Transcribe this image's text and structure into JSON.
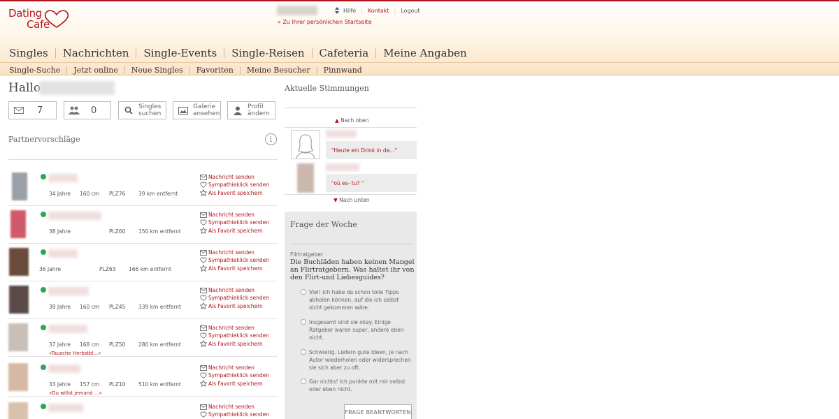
{
  "brand": {
    "line1": "Dating",
    "line2": "Cafe",
    "color": "#b0141c"
  },
  "top_links": {
    "hilfe": "Hilfe",
    "kontakt": "Kontakt",
    "logout": "Logout",
    "startseite": "» Zu Ihrer persönlichen Startseite"
  },
  "main_nav": [
    "Singles",
    "Nachrichten",
    "Single-Events",
    "Single-Reisen",
    "Cafeteria",
    "Meine Angaben"
  ],
  "sub_nav": [
    "Single-Suche",
    "Jetzt online",
    "Neue Singles",
    "Favoriten",
    "Meine Besucher",
    "Pinnwand"
  ],
  "greeting": "Hallo",
  "quick": {
    "messages_count": "7",
    "contacts_count": "0",
    "search_label_1": "Singles",
    "search_label_2": "suchen",
    "gallery_label_1": "Galerie",
    "gallery_label_2": "ansehen",
    "profile_label_1": "Profil",
    "profile_label_2": "ändern"
  },
  "partner_title": "Partnervorschläge",
  "partners": [
    {
      "age": "34 Jahre",
      "height": "160 cm",
      "plz": "PLZ76",
      "distance": "39 km entfernt",
      "status": ""
    },
    {
      "age": "38 Jahre",
      "height": "",
      "plz": "PLZ60",
      "distance": "150 km entfernt",
      "status": ""
    },
    {
      "age": "36 Jahre",
      "height": "",
      "plz": "PLZ63",
      "distance": "166 km entfernt",
      "status": ""
    },
    {
      "age": "39 Jahre",
      "height": "160 cm",
      "plz": "PLZ45",
      "distance": "339 km entfernt",
      "status": ""
    },
    {
      "age": "37 Jahre",
      "height": "168 cm",
      "plz": "PLZ50",
      "distance": "280 km entfernt",
      "status": "»Tausche Herbstbl...«"
    },
    {
      "age": "33 Jahre",
      "height": "157 cm",
      "plz": "PLZ10",
      "distance": "510 km entfernt",
      "status": "»Du willst jemand ...«"
    },
    {
      "age": "",
      "height": "",
      "plz": "",
      "distance": "",
      "status": ""
    }
  ],
  "actions": {
    "message": "Nachricht senden",
    "sympathy": "Sympathieklick senden",
    "favorite": "Als Favorit speichern"
  },
  "stimmungen": {
    "title": "Aktuelle Stimmungen",
    "up": "Nach oben",
    "down": "Nach unten",
    "entries": [
      {
        "text": "\"Heute ein Drink in de...\""
      },
      {
        "text": "\"où es- tu? \""
      }
    ]
  },
  "frage": {
    "title": "Frage der Woche",
    "category": "Flirtratgeber",
    "question": "Die Buchläden haben keinen Mangel an Flirtratgebern. Was haltet ihr von den Flirt-und Liebesguides?",
    "options": [
      "Viel! Ich habe da schon tolle Tipps abholen können, auf die ich selbst nicht gekommen wäre.",
      "Insgesamt sind sie okay. Einige Ratgeber waren super, andere eben nicht.",
      "Schwierig. Liefern gute Ideen, je nach Autor wiederholen oder widersprechen sie sich aber zu oft.",
      "Gar nichts! Ich punkte mit mir selbst oder eben nicht."
    ],
    "button": "FRAGE BEANTWORTEN"
  }
}
